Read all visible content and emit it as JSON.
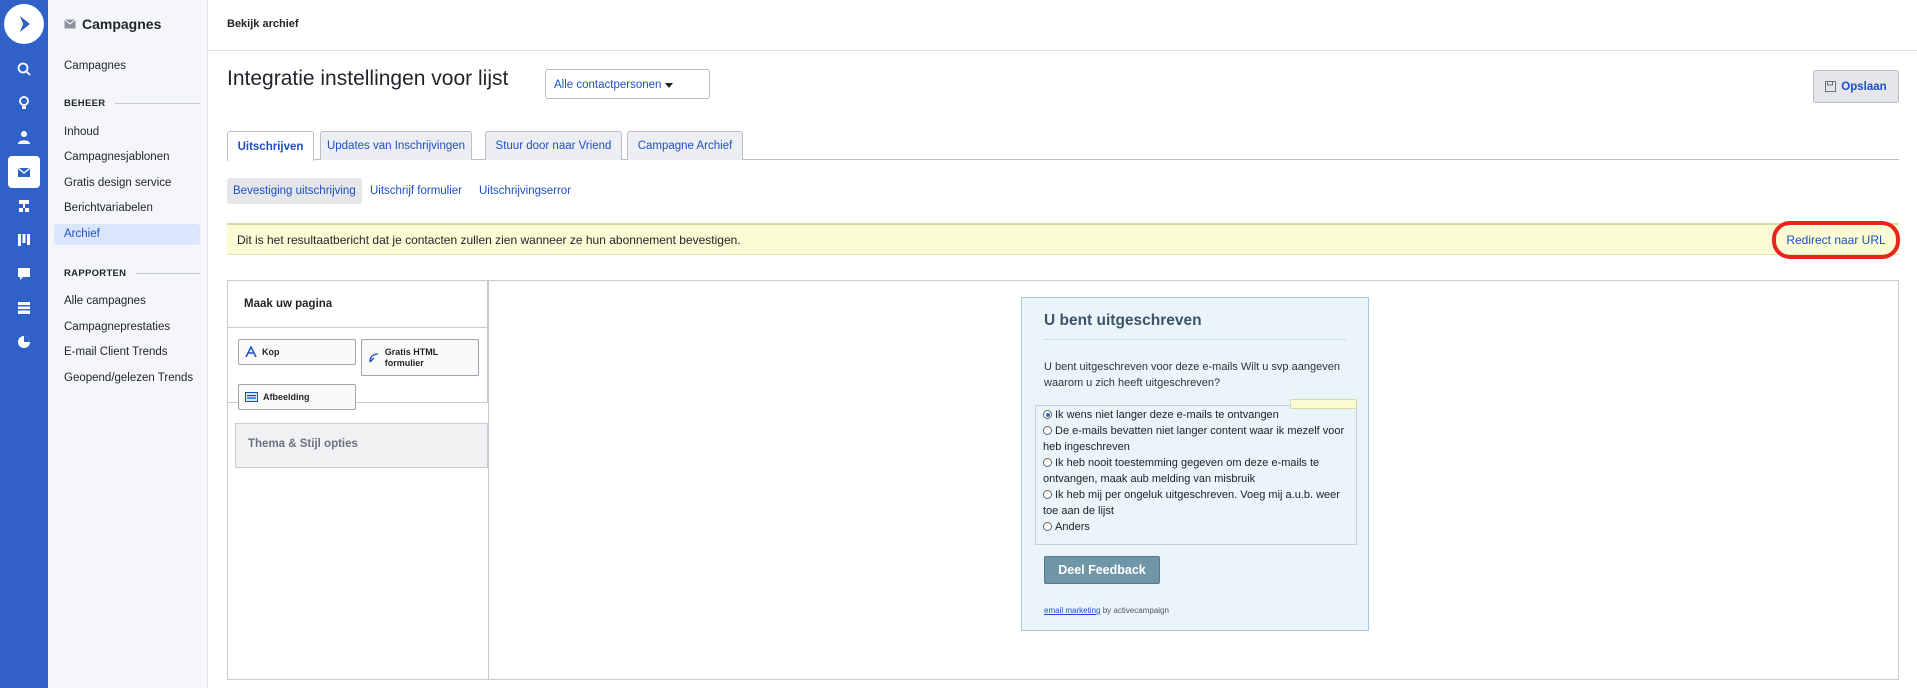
{
  "rail": {
    "icons": [
      "search-icon",
      "lightbulb-icon",
      "contacts-icon",
      "campaigns-icon",
      "automations-icon",
      "deals-icon",
      "conversations-icon",
      "site-icon",
      "reports-icon"
    ]
  },
  "sidebar": {
    "title": "Campagnes",
    "top_items": [
      "Campagnes"
    ],
    "beheer_label": "BEHEER",
    "beheer_items": [
      "Inhoud",
      "Campagnesjablonen",
      "Gratis design service",
      "Berichtvariabelen",
      "Archief"
    ],
    "rapporten_label": "RAPPORTEN",
    "rapporten_items": [
      "Alle campagnes",
      "Campagneprestaties",
      "E-mail Client Trends",
      "Geopend/gelezen Trends"
    ],
    "active_item": "Archief"
  },
  "topbar": {
    "breadcrumb": "Bekijk archief"
  },
  "page": {
    "title": "Integratie instellingen voor lijst",
    "list_select": "Alle contactpersonen",
    "save_label": "Opslaan"
  },
  "tabs": [
    "Uitschrijven",
    "Updates van Inschrijvingen",
    "Stuur door naar Vriend",
    "Campagne Archief"
  ],
  "subtabs": [
    "Bevestiging uitschrijving",
    "Uitschrijf formulier",
    "Uitschrijvingserror"
  ],
  "notice": {
    "text": "Dit is het resultaatbericht dat je contacten zullen zien wanneer ze hun abonnement bevestigen.",
    "redirect_label": "Redirect naar URL"
  },
  "builder": {
    "panel_title": "Maak uw pagina",
    "blocks": [
      "Kop",
      "Gratis HTML formulier",
      "Afbeelding"
    ],
    "theme_label": "Thema & Stijl opties"
  },
  "preview": {
    "heading": "U bent uitgeschreven",
    "intro": "U bent uitgeschreven voor deze e-mails Wilt u svp aangeven waarom u zich heeft uitgeschreven?",
    "options": [
      "Ik wens niet langer deze e-mails te ontvangen",
      "De e-mails bevatten niet langer content waar ik mezelf voor heb ingeschreven",
      "Ik heb nooit toestemming gegeven om deze e-mails te ontvangen, maak aub melding van misbruik",
      "Ik heb mij per ongeluk uitgeschreven. Voeg mij a.u.b. weer toe aan de lijst",
      "Anders"
    ],
    "selected_option": 0,
    "feedback_button": "Deel Feedback",
    "footer_link": "email marketing",
    "footer_text": " by activecampaign"
  },
  "colors": {
    "rail": "#3061c9",
    "link": "#1d4fc4",
    "notice_bg": "#fbfbd4",
    "highlight": "#e8241d"
  }
}
